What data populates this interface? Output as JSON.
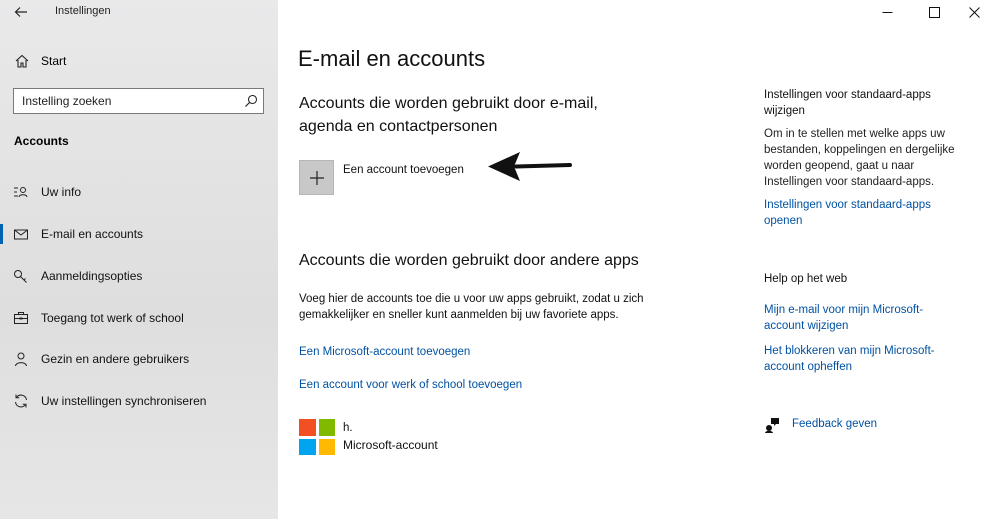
{
  "window": {
    "title": "Instellingen",
    "controls": {
      "minimize": "—",
      "maximize": "☐",
      "close": "✕"
    }
  },
  "sidebar": {
    "home_label": "Start",
    "search": {
      "placeholder": "Instelling zoeken"
    },
    "section_title": "Accounts",
    "items": [
      {
        "label": "Uw info",
        "icon": "person-info-icon"
      },
      {
        "label": "E-mail en accounts",
        "icon": "mail-icon",
        "active": true
      },
      {
        "label": "Aanmeldingsopties",
        "icon": "key-icon"
      },
      {
        "label": "Toegang tot werk of school",
        "icon": "briefcase-icon"
      },
      {
        "label": "Gezin en andere gebruikers",
        "icon": "people-icon"
      },
      {
        "label": "Uw instellingen synchroniseren",
        "icon": "sync-icon"
      }
    ]
  },
  "main": {
    "title": "E-mail en accounts",
    "section1": {
      "heading_line1": "Accounts die worden gebruikt door e-mail,",
      "heading_line2": "agenda en contactpersonen",
      "add_label": "Een account toevoegen"
    },
    "section2": {
      "heading": "Accounts die worden gebruikt door andere apps",
      "description_line1": "Voeg hier de accounts toe die u voor uw apps gebruikt, zodat u zich",
      "description_line2": "gemakkelijker en sneller kunt aanmelden bij uw favoriete apps.",
      "link_microsoft": "Een Microsoft-account toevoegen",
      "link_work": "Een account voor werk of school toevoegen"
    },
    "account": {
      "name": "h.",
      "type": "Microsoft-account"
    }
  },
  "right_panel": {
    "default_apps_heading_1": "Instellingen voor standaard-apps",
    "default_apps_heading_2": "wijzigen",
    "default_apps_text": [
      "Om in te stellen met welke apps uw",
      "bestanden, koppelingen en dergelijke",
      "worden geopend, gaat u naar",
      "Instellingen voor standaard-apps."
    ],
    "default_apps_link_1": "Instellingen voor standaard-apps",
    "default_apps_link_2": "openen",
    "help_heading": "Help op het web",
    "help_link1_line1": "Mijn e-mail voor mijn Microsoft-",
    "help_link1_line2": "account wijzigen",
    "help_link2_line1": "Het blokkeren van mijn Microsoft-",
    "help_link2_line2": "account opheffen",
    "feedback": "Feedback geven"
  },
  "colors": {
    "accent": "#0063b1",
    "link": "#0052a3",
    "ms_red": "#f25022",
    "ms_green": "#7fba00",
    "ms_blue": "#00a4ef",
    "ms_yellow": "#ffb900"
  }
}
